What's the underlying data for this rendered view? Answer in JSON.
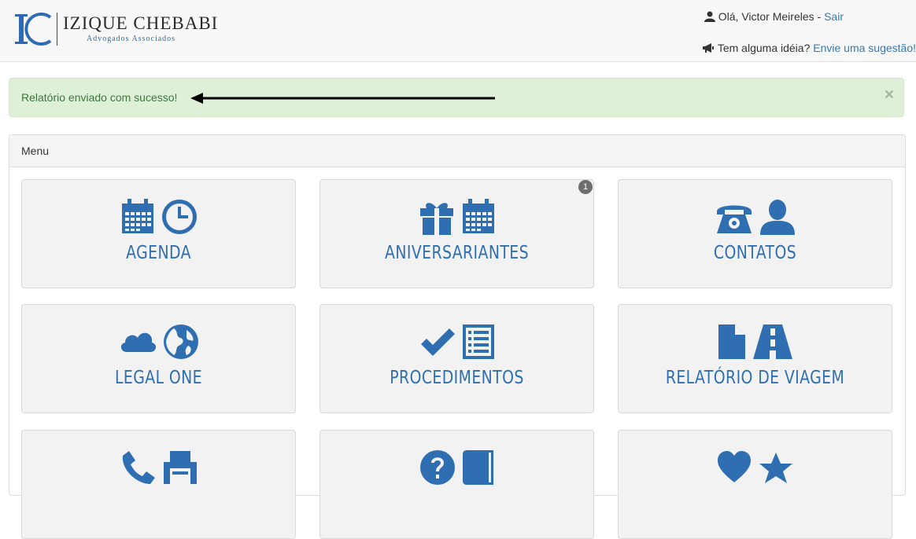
{
  "header": {
    "logo_name": "IZIQUE CHEBABI",
    "logo_subtitle": "Advogados Associados",
    "greeting": "Olá, Victor Meireles - ",
    "logout": "Sair",
    "suggestion_prompt": "Tem alguma idéia? ",
    "suggestion_link": "Envie uma sugestão!"
  },
  "alert": {
    "message": "Relatório enviado com sucesso!",
    "close": "×"
  },
  "panel": {
    "heading": "Menu"
  },
  "tiles": [
    {
      "label": "AGENDA",
      "icons": [
        "calendar-icon",
        "clock-icon"
      ]
    },
    {
      "label": "ANIVERSARIANTES",
      "icons": [
        "gift-icon",
        "calendar-icon"
      ],
      "badge": "1"
    },
    {
      "label": "CONTATOS",
      "icons": [
        "phone-icon",
        "user-icon"
      ]
    },
    {
      "label": "LEGAL ONE",
      "icons": [
        "cloud-icon",
        "globe-icon"
      ]
    },
    {
      "label": "PROCEDIMENTOS",
      "icons": [
        "check-icon",
        "list-icon"
      ]
    },
    {
      "label": "RELATÓRIO DE VIAGEM",
      "icons": [
        "file-icon",
        "road-icon"
      ]
    },
    {
      "label": "",
      "icons": [
        "phone-handset-icon",
        "fax-icon"
      ]
    },
    {
      "label": "",
      "icons": [
        "question-icon",
        "book-icon"
      ]
    },
    {
      "label": "",
      "icons": [
        "heart-icon",
        "star-icon"
      ]
    }
  ],
  "colors": {
    "accent": "#2f6fb1",
    "alert_bg": "#dff0d8",
    "alert_text": "#3c763d",
    "tile_bg": "#f2f2f2"
  }
}
